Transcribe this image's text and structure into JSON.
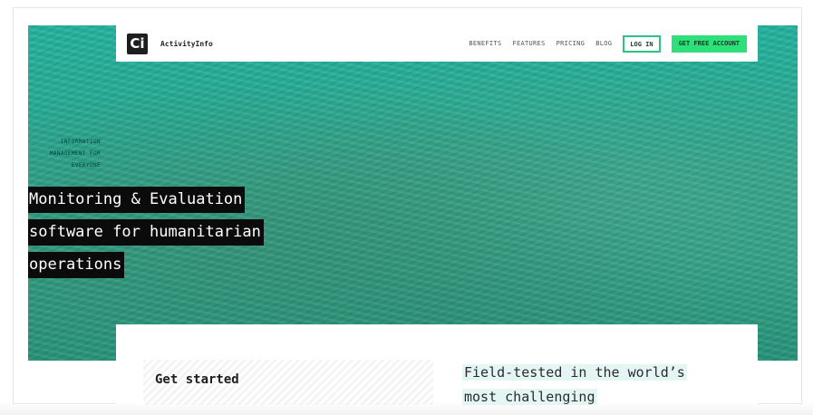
{
  "brand": {
    "logo_glyph": "Ci",
    "name": "ActivityInfo"
  },
  "nav": {
    "links": [
      "BENEFITS",
      "FEATURES",
      "PRICING",
      "BLOG"
    ],
    "login_label": "LOG IN",
    "free_account_label": "GET FREE ACCOUNT"
  },
  "hero": {
    "tagline_lines": [
      "INFORMATION",
      "MANAGEMENT FOR",
      "EVERYONE"
    ],
    "headline_lines": [
      "Monitoring & Evaluation",
      "software for humanitarian",
      "operations"
    ]
  },
  "content": {
    "get_started": "Get started",
    "field_tested_lines": [
      "Field-tested in the world’s",
      "most challenging"
    ]
  },
  "colors": {
    "hero_teal": "#23b6a0",
    "login_border": "#2ac381",
    "free_button": "#2ee07a",
    "headline_bg": "#0b0b0b"
  }
}
